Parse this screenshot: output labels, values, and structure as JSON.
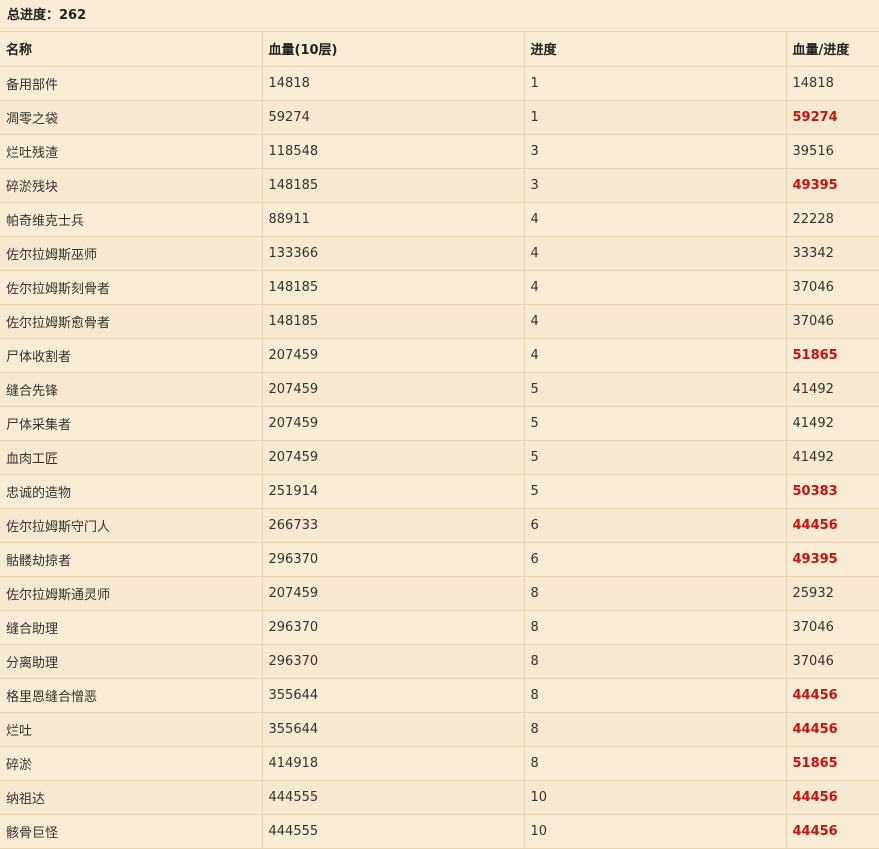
{
  "summary": {
    "label": "总进度：",
    "value": "262"
  },
  "columns": [
    "名称",
    "血量(10层)",
    "进度",
    "血量/进度"
  ],
  "rows": [
    {
      "name": "备用部件",
      "hp": "14818",
      "progress": "1",
      "ratio": "14818",
      "highlight": false
    },
    {
      "name": "凋零之袋",
      "hp": "59274",
      "progress": "1",
      "ratio": "59274",
      "highlight": true
    },
    {
      "name": "烂吐残渣",
      "hp": "118548",
      "progress": "3",
      "ratio": "39516",
      "highlight": false
    },
    {
      "name": "碎淤残块",
      "hp": "148185",
      "progress": "3",
      "ratio": "49395",
      "highlight": true
    },
    {
      "name": "帕奇维克士兵",
      "hp": "88911",
      "progress": "4",
      "ratio": "22228",
      "highlight": false
    },
    {
      "name": "佐尔拉姆斯巫师",
      "hp": "133366",
      "progress": "4",
      "ratio": "33342",
      "highlight": false
    },
    {
      "name": "佐尔拉姆斯刻骨者",
      "hp": "148185",
      "progress": "4",
      "ratio": "37046",
      "highlight": false
    },
    {
      "name": "佐尔拉姆斯愈骨者",
      "hp": "148185",
      "progress": "4",
      "ratio": "37046",
      "highlight": false
    },
    {
      "name": "尸体收割者",
      "hp": "207459",
      "progress": "4",
      "ratio": "51865",
      "highlight": true
    },
    {
      "name": "缝合先锋",
      "hp": "207459",
      "progress": "5",
      "ratio": "41492",
      "highlight": false
    },
    {
      "name": "尸体采集者",
      "hp": "207459",
      "progress": "5",
      "ratio": "41492",
      "highlight": false
    },
    {
      "name": "血肉工匠",
      "hp": "207459",
      "progress": "5",
      "ratio": "41492",
      "highlight": false
    },
    {
      "name": "忠诚的造物",
      "hp": "251914",
      "progress": "5",
      "ratio": "50383",
      "highlight": true
    },
    {
      "name": "佐尔拉姆斯守门人",
      "hp": "266733",
      "progress": "6",
      "ratio": "44456",
      "highlight": true
    },
    {
      "name": "骷髅劫掠者",
      "hp": "296370",
      "progress": "6",
      "ratio": "49395",
      "highlight": true
    },
    {
      "name": "佐尔拉姆斯通灵师",
      "hp": "207459",
      "progress": "8",
      "ratio": "25932",
      "highlight": false
    },
    {
      "name": "缝合助理",
      "hp": "296370",
      "progress": "8",
      "ratio": "37046",
      "highlight": false
    },
    {
      "name": "分离助理",
      "hp": "296370",
      "progress": "8",
      "ratio": "37046",
      "highlight": false
    },
    {
      "name": "格里恩缝合憎恶",
      "hp": "355644",
      "progress": "8",
      "ratio": "44456",
      "highlight": true
    },
    {
      "name": "烂吐",
      "hp": "355644",
      "progress": "8",
      "ratio": "44456",
      "highlight": true
    },
    {
      "name": "碎淤",
      "hp": "414918",
      "progress": "8",
      "ratio": "51865",
      "highlight": true
    },
    {
      "name": "纳祖达",
      "hp": "444555",
      "progress": "10",
      "ratio": "44456",
      "highlight": true
    },
    {
      "name": "骸骨巨怪",
      "hp": "444555",
      "progress": "10",
      "ratio": "44456",
      "highlight": true
    }
  ],
  "colors": {
    "highlight": "#cc1111",
    "background": "#f8ecd4",
    "border": "#e8d3ad"
  }
}
